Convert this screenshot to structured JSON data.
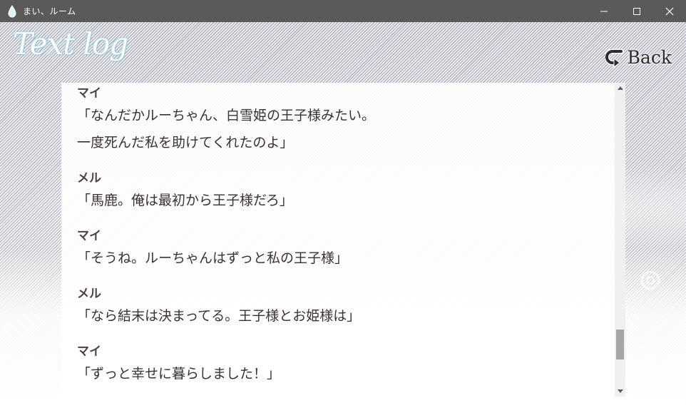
{
  "window": {
    "title": "まい、ルーム",
    "icon": "water-drop-icon",
    "buttons": [
      "minimize-icon",
      "maximize-icon",
      "close-icon"
    ]
  },
  "screen": {
    "title": "Text log",
    "back_label": "Back",
    "back_icon": "return-arrow-icon"
  },
  "log": {
    "entries": [
      {
        "speaker": "マイ",
        "lines": [
          "「なんだかルーちゃん、白雪姫の王子様みたい。",
          "一度死んだ私を助けてくれたのよ」"
        ]
      },
      {
        "speaker": "メル",
        "lines": [
          "「馬鹿。俺は最初から王子様だろ」"
        ]
      },
      {
        "speaker": "マイ",
        "lines": [
          "「そうね。ルーちゃんはずっと私の王子様」"
        ]
      },
      {
        "speaker": "メル",
        "lines": [
          "「なら結末は決まってる。王子様とお姫様は」"
        ]
      },
      {
        "speaker": "マイ",
        "lines": [
          "「ずっと幸せに暮らしました！」"
        ]
      }
    ],
    "scroll_position": 0.9
  },
  "colors": {
    "titlebar": "#5a5a5a",
    "speaker": "#4d4141",
    "text": "#3a3232",
    "title_glow": "#9fc8d6"
  }
}
